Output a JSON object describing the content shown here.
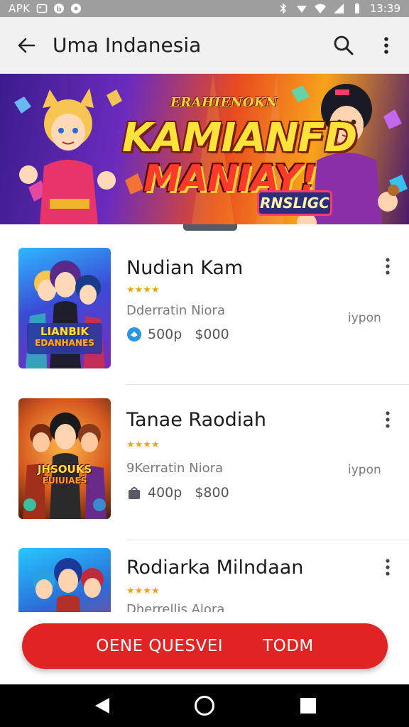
{
  "status_bar": {
    "left_text": "APK",
    "time": "13:39"
  },
  "app_bar": {
    "title": "Uma Indanesia",
    "back_icon": "arrow-left-icon",
    "search_icon": "search-icon",
    "more_icon": "more-vert-icon"
  },
  "banner": {
    "subtitle": "ERAHIENOKN",
    "headline_line1": "KAMIANFD",
    "headline_line2": "MANIAY!",
    "badge": "RNSLIGC"
  },
  "list": {
    "items": [
      {
        "name": "Nudian Kam",
        "developer": "Dderratin Niora",
        "type": "iypon",
        "price_a": "500p",
        "price_b": "$000",
        "thumb_text_line1": "LIANBIK",
        "thumb_text_line2": "EDANHANES",
        "stars": "★★★★",
        "colors": {
          "a": "#2a6fd0",
          "b": "#b54fd8",
          "c": "#f0b629"
        }
      },
      {
        "name": "Tanae Raodiah",
        "developer": "9Kerratin Niora",
        "type": "iypon",
        "price_a": "400p",
        "price_b": "$800",
        "thumb_text_line1": "JHSOUKS",
        "thumb_text_line2": "EUIUIAES",
        "stars": "★★★★",
        "colors": {
          "a": "#7a2c12",
          "b": "#d4772a",
          "c": "#f4c430"
        }
      },
      {
        "name": "Rodiarka Milndaan",
        "developer": "Dherrellis Alora",
        "type": "",
        "stars": "★★★★",
        "colors": {
          "a": "#1b7bd1",
          "b": "#d12a4a",
          "c": "#39c07a"
        }
      }
    ]
  },
  "cta": {
    "label_left": "OENE QUESVEI",
    "label_right": "TODM",
    "color": "#e02424"
  }
}
